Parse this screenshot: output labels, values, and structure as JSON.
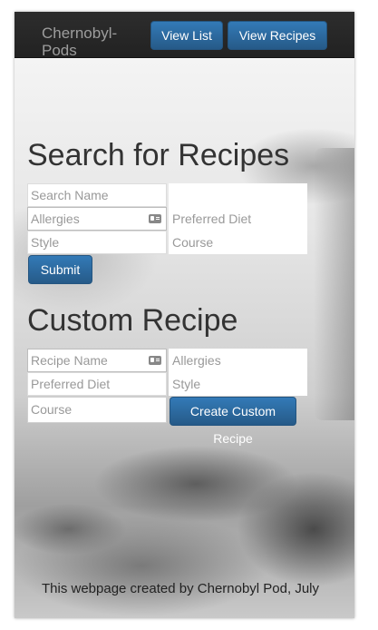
{
  "navbar": {
    "brand": "Chernobyl-Pods",
    "view_list_label": "View List",
    "view_recipes_label": "View Recipes"
  },
  "search": {
    "heading": "Search for Recipes",
    "search_name_placeholder": "Search Name",
    "allergies_placeholder": "Allergies",
    "preferred_diet_placeholder": "Preferred Diet",
    "style_placeholder": "Style",
    "course_placeholder": "Course",
    "submit_label": "Submit"
  },
  "custom": {
    "heading": "Custom Recipe",
    "recipe_name_placeholder": "Recipe Name",
    "allergies_placeholder": "Allergies",
    "preferred_diet_placeholder": "Preferred Diet",
    "style_placeholder": "Style",
    "course_placeholder": "Course",
    "create_label": "Create Custom Recipe"
  },
  "footer": {
    "text": "This webpage created by Chernobyl Pod, July"
  },
  "colors": {
    "navbar_bg": "#222222",
    "brand_text": "#9d9d9d",
    "button_primary": "#337ab7",
    "heading_text": "#333333"
  },
  "icons": {
    "autofill": "contact-card-icon"
  }
}
